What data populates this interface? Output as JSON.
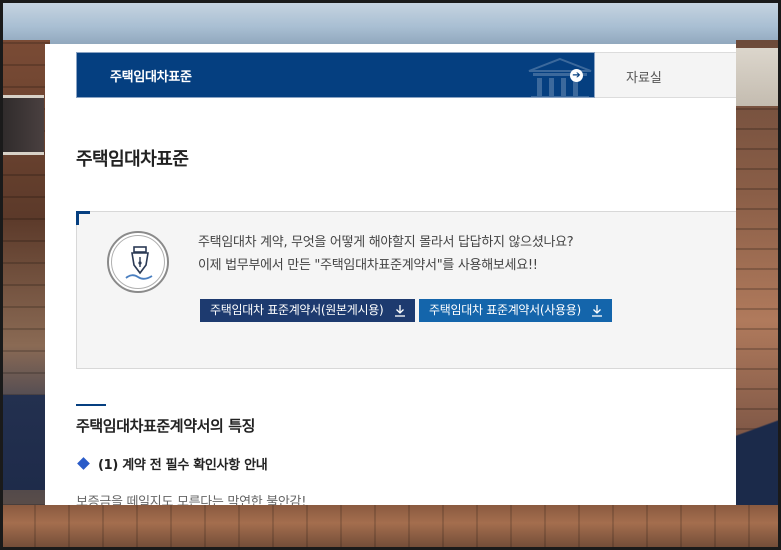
{
  "nav": {
    "active_label": "주택임대차표준",
    "next_label": "자료실"
  },
  "page_title": "주택임대차표준",
  "info": {
    "line1": "주택임대차 계약, 무엇을 어떻게 해야할지 몰라서 답답하지 않으셨나요?",
    "line2": "이제 법무부에서 만든 \"주택임대차표준계약서\"를 사용해보세요!!",
    "button_original": "주택임대차 표준계약서(원본게시용)",
    "button_user": "주택임대차 표준계약서(사용용)"
  },
  "features": {
    "title": "주택임대차표준계약서의 특징",
    "item1_title": "(1) 계약 전 필수 확인사항 안내",
    "item1_text": "보증금을 떼일지도 모른다는 막연한 불안감!"
  },
  "colors": {
    "primary_navy": "#053f80",
    "button_dark": "#1d3a6f",
    "button_blue": "#1465ab",
    "accent_diamond": "#2a5bc8"
  }
}
